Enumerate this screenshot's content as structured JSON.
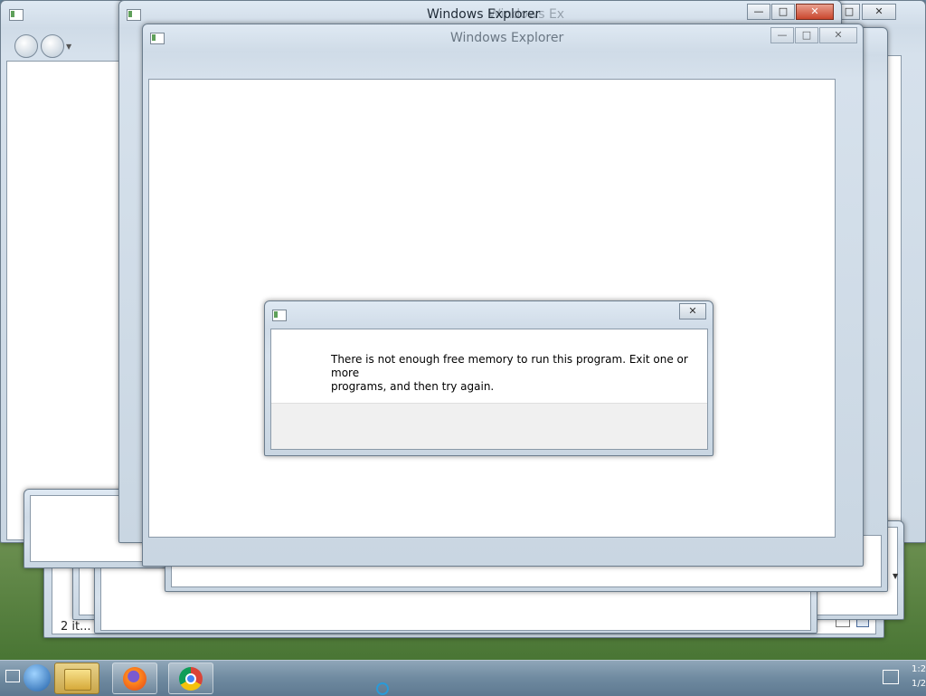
{
  "windows": {
    "back_left": {
      "title": ""
    },
    "main": {
      "title_overlap_a": "Windows Ex",
      "title_overlap_b": "Windows Explorer",
      "title_ghost": "Windows Explorer",
      "min": "—",
      "max": "□",
      "close": "✕"
    },
    "second": {
      "title": "Windows Explorer",
      "min": "—",
      "max": "□",
      "close": "✕"
    },
    "back_right": {
      "max": "□",
      "close": "✕"
    }
  },
  "stacked_window": {
    "status_text": "2 it..."
  },
  "dialog": {
    "close": "✕",
    "message_line1": "There is not enough free memory to run this program. Exit one or more",
    "message_line2": "programs, and then try again."
  },
  "taskbar": {
    "items": [
      {
        "name": "start-orb",
        "icon": "windows-orb-icon"
      },
      {
        "name": "explorer",
        "icon": "folder-icon"
      },
      {
        "name": "firefox",
        "icon": "firefox-icon"
      },
      {
        "name": "chrome",
        "icon": "chrome-icon"
      }
    ],
    "clock_time": "1:2",
    "clock_date": "1/2"
  },
  "colors": {
    "dialog_footer": "#f0f0f0",
    "close_red": "#c9462d",
    "taskbar": "#6f8aa0"
  }
}
